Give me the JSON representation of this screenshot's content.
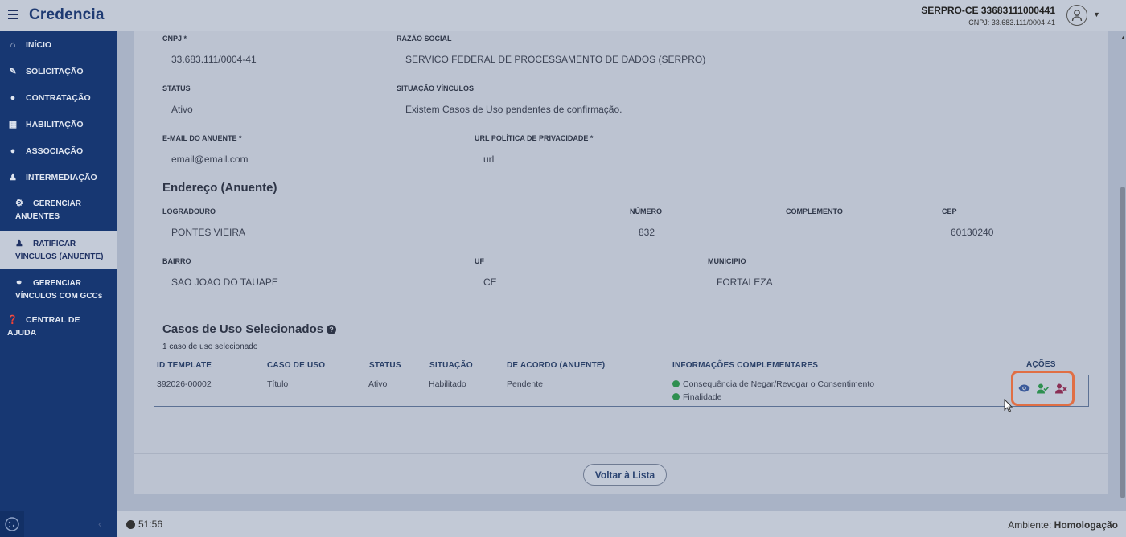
{
  "header": {
    "brand": "Credencia",
    "org_name": "SERPRO-CE 33683111000441",
    "org_cnpj": "CNPJ: 33.683.111/0004-41"
  },
  "sidebar": {
    "items": [
      {
        "label": "INÍCIO",
        "icon": "home-icon"
      },
      {
        "label": "SOLICITAÇÃO",
        "icon": "edit-document-icon"
      },
      {
        "label": "CONTRATAÇÃO",
        "icon": "handshake-icon"
      },
      {
        "label": "HABILITAÇÃO",
        "icon": "id-card-icon"
      },
      {
        "label": "ASSOCIAÇÃO",
        "icon": "users-icon"
      },
      {
        "label": "INTERMEDIAÇÃO",
        "icon": "user-cog-icon"
      }
    ],
    "subitems": [
      {
        "label_1": "GERENCIAR",
        "label_2": "ANUENTES"
      },
      {
        "label_1": "RATIFICAR",
        "label_2": "VÍNCULOS (ANUENTE)"
      },
      {
        "label_1": "GERENCIAR",
        "label_2": "VÍNCULOS COM GCCs"
      }
    ],
    "help": {
      "label_1": "CENTRAL DE",
      "label_2": "AJUDA"
    }
  },
  "form": {
    "cnpj_label": "CNPJ *",
    "cnpj_value": "33.683.111/0004-41",
    "razao_label": "RAZÃO SOCIAL",
    "razao_value": "SERVICO FEDERAL DE PROCESSAMENTO DE DADOS (SERPRO)",
    "status_label": "STATUS",
    "status_value": "Ativo",
    "situacao_label": "SITUAÇÃO VÍNCULOS",
    "situacao_value": "Existem Casos de Uso pendentes de confirmação.",
    "email_label": "E-MAIL DO ANUENTE *",
    "email_value": "email@email.com",
    "url_label": "URL POLÍTICA DE PRIVACIDADE *",
    "url_value": "url"
  },
  "address": {
    "title": "Endereço (Anuente)",
    "logradouro_label": "LOGRADOURO",
    "logradouro_value": "PONTES VIEIRA",
    "numero_label": "NÚMERO",
    "numero_value": "832",
    "complemento_label": "COMPLEMENTO",
    "complemento_value": "",
    "cep_label": "CEP",
    "cep_value": "60130240",
    "bairro_label": "BAIRRO",
    "bairro_value": "SAO JOAO DO TAUAPE",
    "uf_label": "UF",
    "uf_value": "CE",
    "municipio_label": "MUNICIPIO",
    "municipio_value": "FORTALEZA"
  },
  "usecases": {
    "title": "Casos de Uso Selecionados",
    "count": "1 caso de uso selecionado",
    "headers": {
      "id": "ID TEMPLATE",
      "caso": "CASO DE USO",
      "status": "STATUS",
      "situacao": "SITUAÇÃO",
      "acordo": "DE ACORDO (ANUENTE)",
      "info": "INFORMAÇÕES COMPLEMENTARES",
      "acoes": "AÇÕES"
    },
    "rows": [
      {
        "id": "392026-00002",
        "caso": "Título",
        "status": "Ativo",
        "situacao": "Habilitado",
        "acordo": "Pendente",
        "info_1": "Consequência de Negar/Revogar o Consentimento",
        "info_2": "Finalidade"
      }
    ]
  },
  "footer": {
    "back_button": "Voltar à Lista",
    "timer": "51:56",
    "env_label": "Ambiente:",
    "env_value": "Homologação"
  },
  "colors": {
    "sidebar": "#173772",
    "highlight": "#e06f45",
    "view_icon": "#3b5a9a",
    "approve_icon": "#2e8f50",
    "reject_icon": "#8a2f55"
  }
}
